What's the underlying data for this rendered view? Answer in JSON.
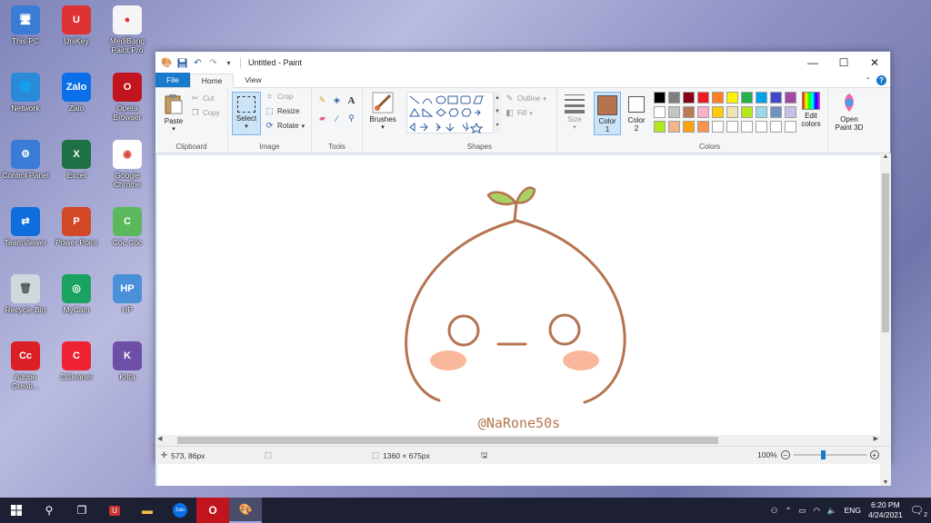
{
  "desktop": {
    "icons": [
      {
        "label": "This PC",
        "glyph": "🖥"
      },
      {
        "label": "UniKey",
        "glyph": "U"
      },
      {
        "label": "MediBang Paint Pro",
        "glyph": "●"
      },
      {
        "label": "Network",
        "glyph": "🌐"
      },
      {
        "label": "Zalo",
        "glyph": "Zalo"
      },
      {
        "label": "Opera Browser",
        "glyph": "O"
      },
      {
        "label": "Control Panel",
        "glyph": "⚙"
      },
      {
        "label": "Excel",
        "glyph": "X"
      },
      {
        "label": "Google Chrome",
        "glyph": "◉"
      },
      {
        "label": "TeamViewer",
        "glyph": "⇄"
      },
      {
        "label": "Power Point",
        "glyph": "P"
      },
      {
        "label": "Cốc Cốc",
        "glyph": "C"
      },
      {
        "label": "Recycle Bin",
        "glyph": "🗑"
      },
      {
        "label": "MyCam",
        "glyph": "◎"
      },
      {
        "label": "HP",
        "glyph": "HP"
      },
      {
        "label": "Adobe Creati...",
        "glyph": "Cc"
      },
      {
        "label": "CCleaner",
        "glyph": "C"
      },
      {
        "label": "Krita",
        "glyph": "K"
      }
    ]
  },
  "window": {
    "title": "Untitled - Paint",
    "controls": {
      "minimize": "—",
      "maximize": "☐",
      "close": "✕"
    },
    "quick_access": [
      "paint-icon",
      "save-icon",
      "undo-icon",
      "redo-icon",
      "customize-icon"
    ],
    "help": "?"
  },
  "tabs": {
    "file": "File",
    "home": "Home",
    "view": "View"
  },
  "ribbon": {
    "clipboard": {
      "label": "Clipboard",
      "paste": "Paste",
      "cut": "Cut",
      "copy": "Copy"
    },
    "image": {
      "label": "Image",
      "select": "Select",
      "crop": "Crop",
      "resize": "Resize",
      "rotate": "Rotate"
    },
    "tools": {
      "label": "Tools"
    },
    "brushes": {
      "label": "Brushes"
    },
    "shapes": {
      "label": "Shapes",
      "outline": "Outline",
      "fill": "Fill"
    },
    "size": {
      "label": "Size"
    },
    "colors": {
      "label": "Colors",
      "color1": "Color\n1",
      "color1_label": "Color",
      "color1_num": "1",
      "color2_label": "Color",
      "color2_num": "2",
      "color1_value": "#b5744f",
      "color2_value": "#ffffff",
      "edit": "Edit colors",
      "edit_l1": "Edit",
      "edit_l2": "colors",
      "palette_row1": [
        "#000000",
        "#7f7f7f",
        "#880015",
        "#ed1c24",
        "#ff7f27",
        "#fff200",
        "#22b14c",
        "#00a2e8",
        "#3f48cc",
        "#a349a4"
      ],
      "palette_row2": [
        "#ffffff",
        "#c3c3c3",
        "#b97a57",
        "#ffaec9",
        "#ffc90e",
        "#efe4b0",
        "#b5e61d",
        "#99d9ea",
        "#7092be",
        "#c8bfe7"
      ],
      "palette_row3": [
        "#b5e61d",
        "#f2b48a",
        "#ffa20f",
        "#f7934f",
        "#ffffff",
        "#ffffff",
        "#ffffff",
        "#ffffff",
        "#ffffff",
        "#ffffff"
      ]
    },
    "paint3d": {
      "l1": "Open",
      "l2": "Paint 3D"
    }
  },
  "canvas": {
    "watermark": "@NaRone50s",
    "stroke_color": "#b5744f",
    "leaf_color": "#a9d163",
    "blush_color": "#f9b89c"
  },
  "status": {
    "cursor": "573, 86px",
    "size": "1360 × 675px",
    "zoom": "100%",
    "zoom_level": 1.0
  },
  "taskbar": {
    "items": [
      "start",
      "search",
      "task-view",
      "unikey",
      "file-explorer",
      "zalo",
      "opera",
      "paint"
    ],
    "tray_lang": "ENG",
    "time": "6:20 PM",
    "date": "4/24/2021",
    "notifications": "2"
  }
}
